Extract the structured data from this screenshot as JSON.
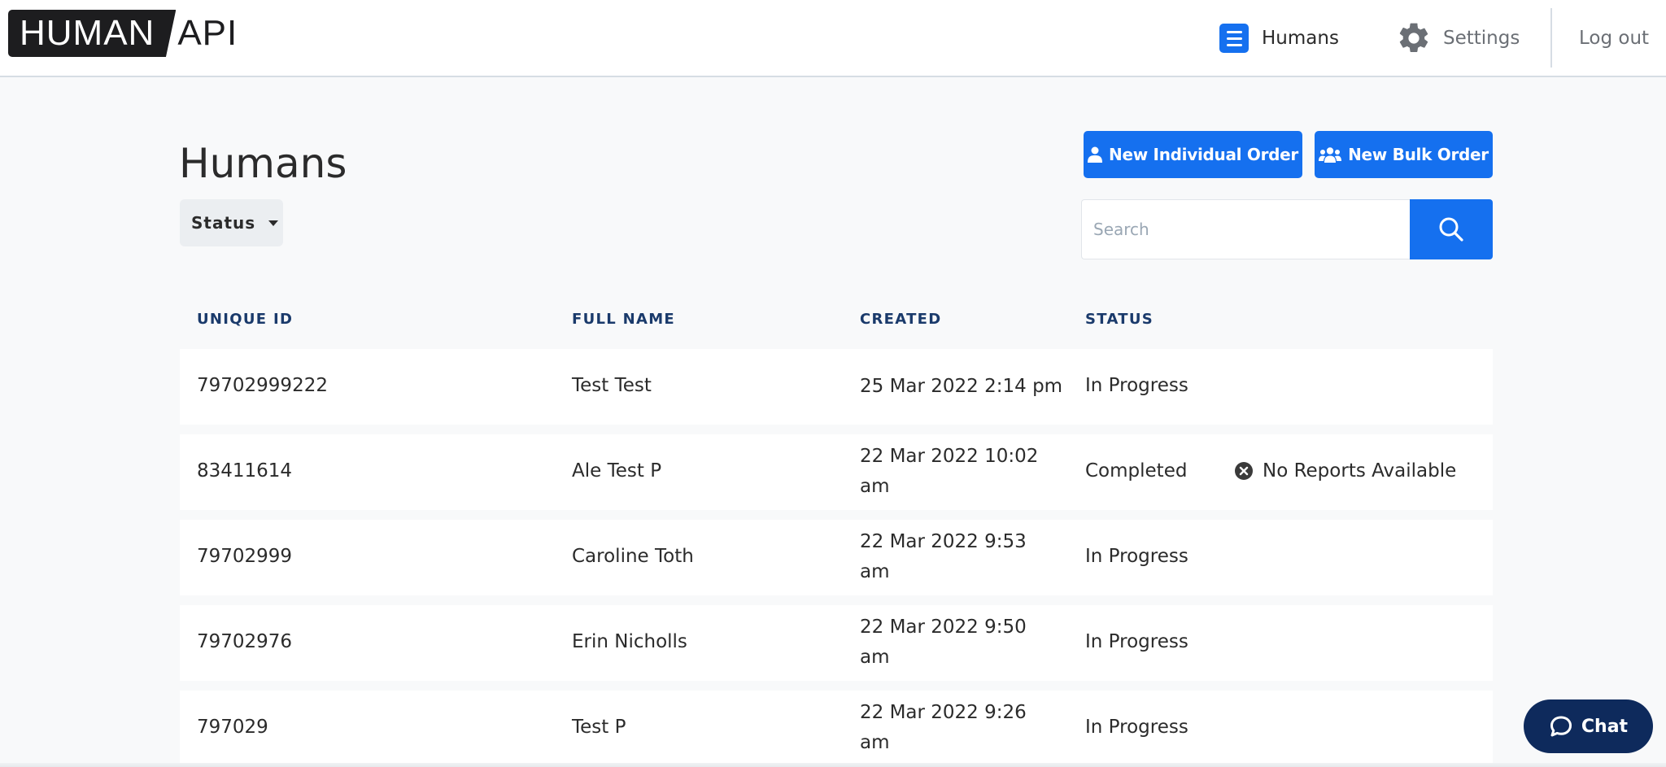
{
  "header": {
    "logo_left": "HUMAN",
    "logo_right": "API",
    "nav_humans": "Humans",
    "nav_settings": "Settings",
    "nav_logout": "Log out"
  },
  "page": {
    "title": "Humans",
    "status_filter": "Status",
    "new_individual_order": "New Individual Order",
    "new_bulk_order": "New Bulk Order",
    "search_placeholder": "Search"
  },
  "table": {
    "columns": [
      "UNIQUE ID",
      "FULL NAME",
      "CREATED",
      "STATUS"
    ],
    "rows": [
      {
        "id": "79702999222",
        "name": "Test Test",
        "created": "25 Mar 2022 2:14 pm",
        "status": "In Progress",
        "report": ""
      },
      {
        "id": "83411614",
        "name": "Ale Test P",
        "created": "22 Mar 2022 10:02 am",
        "status": "Completed",
        "report": "No Reports Available"
      },
      {
        "id": "79702999",
        "name": "Caroline Toth",
        "created": "22 Mar 2022 9:53 am",
        "status": "In Progress",
        "report": ""
      },
      {
        "id": "79702976",
        "name": "Erin Nicholls",
        "created": "22 Mar 2022 9:50 am",
        "status": "In Progress",
        "report": ""
      },
      {
        "id": "797029",
        "name": "Test P",
        "created": "22 Mar 2022 9:26 am",
        "status": "In Progress",
        "report": ""
      }
    ]
  },
  "chat": {
    "label": "Chat"
  },
  "colors": {
    "primary": "#1570ef",
    "navy": "#0e2a5c",
    "header_text": "#1a3a6b"
  },
  "icons": [
    "list-icon",
    "gear-icon",
    "user-icon",
    "users-icon",
    "search-icon",
    "x-circle-icon",
    "chat-bubble-icon"
  ]
}
